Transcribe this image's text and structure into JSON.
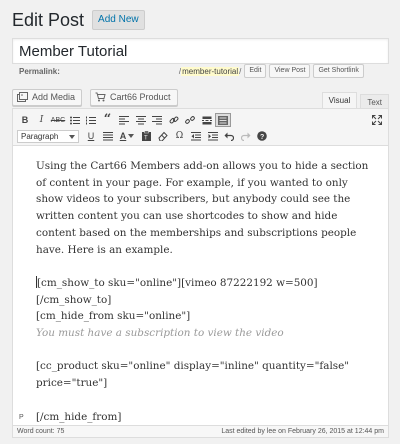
{
  "header": {
    "title": "Edit Post",
    "add_new_label": "Add New"
  },
  "title_field": {
    "value": "Member Tutorial"
  },
  "permalink": {
    "label": "Permalink:",
    "prefix": "/",
    "slug": "member-tutorial",
    "suffix": "/",
    "edit_label": "Edit",
    "view_label": "View Post",
    "shortlink_label": "Get Shortlink"
  },
  "media_buttons": {
    "add_media": "Add Media",
    "cart66_product": "Cart66 Product"
  },
  "editor_tabs": {
    "visual": "Visual",
    "text": "Text",
    "active": "Visual"
  },
  "toolbar": {
    "row1": [
      "bold",
      "italic",
      "strikethrough",
      "bullet-list",
      "numbered-list",
      "blockquote",
      "align-left",
      "align-center",
      "align-right",
      "link",
      "unlink",
      "read-more",
      "toolbar-toggle"
    ],
    "row2_format": "Paragraph",
    "row2": [
      "underline",
      "justify",
      "text-color",
      "paste-as-text",
      "clear-formatting",
      "special-character",
      "outdent",
      "indent",
      "undo",
      "redo",
      "help"
    ]
  },
  "content": {
    "paragraph1": "Using the Cart66 Members add-on allows you to hide a section of content in your page. For example, if you wanted to only show videos to your subscribers, but anybody could see the written content you can use shortcodes to show and hide content based on the memberships and subscriptions people have. Here is an example.",
    "line_show": "[cm_show_to sku=\"online\"][vimeo 87222192 w=500][/cm_show_to]",
    "line_hide": "[cm_hide_from sku=\"online\"]",
    "line_notice": "You must have a subscription to view the video",
    "line_product_1": "[cc_product sku=\"online\" display=\"inline\" quantity=\"false\"",
    "line_product_2": "price=\"true\"]",
    "line_hide_end": "[/cm_hide_from]"
  },
  "path_indicator": "P",
  "footer": {
    "word_count_label": "Word count:",
    "word_count": "75",
    "last_edited": "Last edited by lee on February 26, 2015 at 12:44 pm"
  }
}
